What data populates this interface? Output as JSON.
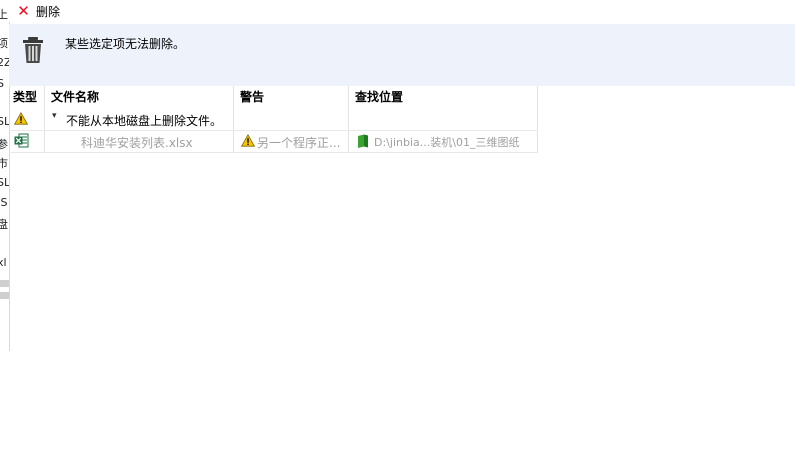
{
  "dialog": {
    "title": "删除",
    "message": "某些选定项无法删除。"
  },
  "table": {
    "headers": {
      "type": "类型",
      "file_name": "文件名称",
      "warning": "警告",
      "location": "查找位置"
    },
    "group": {
      "label": "不能从本地磁盘上删除文件。",
      "icon": "warning-icon",
      "expanded": true
    },
    "rows": [
      {
        "icon": "excel-file-icon",
        "file_name": "科迪华安装列表.xlsx",
        "warning": "另一个程序正...",
        "warning_icon": "warning-icon",
        "location": "D:\\jinbia...装机\\01_三维图纸",
        "location_icon": "green-book-icon"
      }
    ]
  },
  "background_window": {
    "fragments": [
      "上",
      "项",
      "2Z",
      "S",
      "SL",
      "参",
      "市",
      "SL",
      ".S",
      "盘",
      "xl"
    ]
  },
  "colors": {
    "close": "#e81123",
    "banner_bg": "#eef3fb",
    "warning_yellow": "#f7c600",
    "excel_green": "#1f7244",
    "book_green": "#3aa333"
  }
}
